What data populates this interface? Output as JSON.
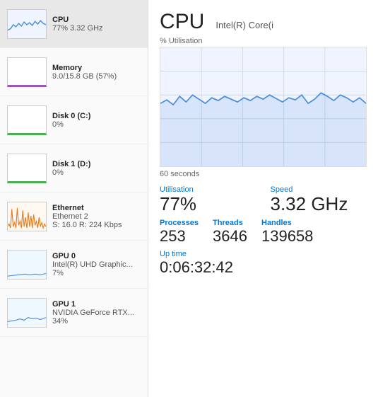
{
  "sidebar": {
    "items": [
      {
        "id": "cpu",
        "label": "CPU",
        "sub1": "77% 3.32 GHz",
        "sub2": "",
        "active": true,
        "thumb_type": "cpu"
      },
      {
        "id": "memory",
        "label": "Memory",
        "sub1": "9.0/15.8 GB (57%)",
        "sub2": "",
        "active": false,
        "thumb_type": "memory"
      },
      {
        "id": "disk0",
        "label": "Disk 0 (C:)",
        "sub1": "0%",
        "sub2": "",
        "active": false,
        "thumb_type": "disk0"
      },
      {
        "id": "disk1",
        "label": "Disk 1 (D:)",
        "sub1": "0%",
        "sub2": "",
        "active": false,
        "thumb_type": "disk1"
      },
      {
        "id": "ethernet",
        "label": "Ethernet",
        "sub1": "Ethernet 2",
        "sub2": "S: 16.0  R: 224 Kbps",
        "active": false,
        "thumb_type": "ethernet"
      },
      {
        "id": "gpu0",
        "label": "GPU 0",
        "sub1": "Intel(R) UHD Graphic...",
        "sub2": "7%",
        "active": false,
        "thumb_type": "gpu0"
      },
      {
        "id": "gpu1",
        "label": "GPU 1",
        "sub1": "NVIDIA GeForce RTX...",
        "sub2": "34%",
        "active": false,
        "thumb_type": "gpu1"
      }
    ]
  },
  "main": {
    "title": "CPU",
    "subtitle": "Intel(R) Core(i",
    "chart_label": "% Utilisation",
    "chart_time": "60 seconds",
    "stats": {
      "utilisation_label": "Utilisation",
      "utilisation_value": "77%",
      "speed_label": "Speed",
      "speed_value": "3.32 GHz",
      "processes_label": "Processes",
      "processes_value": "253",
      "threads_label": "Threads",
      "threads_value": "3646",
      "handles_label": "Handles",
      "handles_value": "139658",
      "uptime_label": "Up time",
      "uptime_value": "0:06:32:42"
    }
  }
}
